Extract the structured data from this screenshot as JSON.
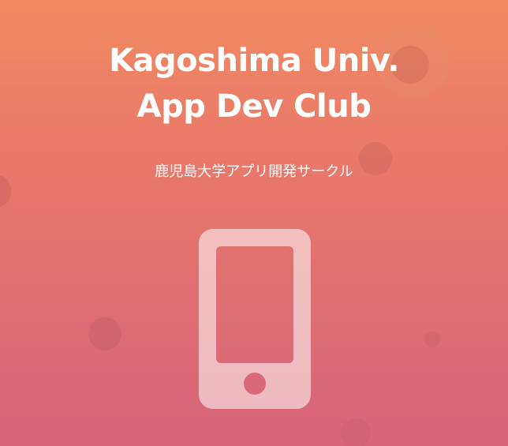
{
  "hero": {
    "title_line1": "Kagoshima Univ.",
    "title_line2": "App Dev Club",
    "subtitle": "鹿児島大学アプリ開発サークル",
    "icon": "smartphone-icon",
    "colors": {
      "gradient_top": "#f08a60",
      "gradient_bottom": "#d7657a",
      "text": "#ffffff"
    }
  }
}
